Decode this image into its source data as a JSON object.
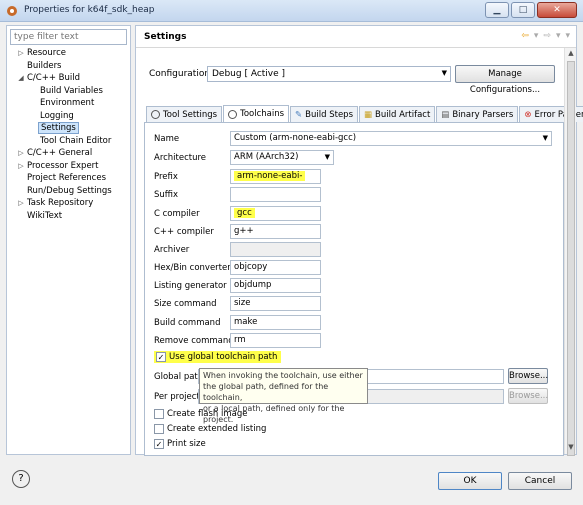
{
  "window": {
    "title": "Properties for k64f_sdk_heap",
    "minimize": "▁",
    "maximize": "□",
    "close": "✕"
  },
  "nav": {
    "filter_placeholder": "type filter text",
    "items": [
      {
        "label": "Resource",
        "arrow": "▷"
      },
      {
        "label": "Builders",
        "arrow": ""
      },
      {
        "label": "C/C++ Build",
        "arrow": "◢"
      },
      {
        "label": "Build Variables",
        "arrow": ""
      },
      {
        "label": "Environment",
        "arrow": ""
      },
      {
        "label": "Logging",
        "arrow": ""
      },
      {
        "label": "Settings",
        "arrow": ""
      },
      {
        "label": "Tool Chain Editor",
        "arrow": ""
      },
      {
        "label": "C/C++ General",
        "arrow": "▷"
      },
      {
        "label": "Processor Expert",
        "arrow": "▷"
      },
      {
        "label": "Project References",
        "arrow": ""
      },
      {
        "label": "Run/Debug Settings",
        "arrow": ""
      },
      {
        "label": "Task Repository",
        "arrow": "▷"
      },
      {
        "label": "WikiText",
        "arrow": ""
      }
    ]
  },
  "header": {
    "title": "Settings",
    "back_icon": "⇦",
    "fwd_icon": "⇨",
    "dropdown": "▾",
    "menu": "▾"
  },
  "config": {
    "label": "Configuration:",
    "value": "Debug  [ Active ]",
    "manage": "Manage Configurations..."
  },
  "tabs": [
    "Tool Settings",
    "Toolchains",
    "Build Steps",
    "Build Artifact",
    "Binary Parsers",
    "Error Parsers"
  ],
  "form": {
    "name": {
      "label": "Name",
      "value": "Custom (arm-none-eabi-gcc)"
    },
    "architecture": {
      "label": "Architecture",
      "value": "ARM (AArch32)"
    },
    "prefix": {
      "label": "Prefix",
      "value": "arm-none-eabi-"
    },
    "suffix": {
      "label": "Suffix",
      "value": ""
    },
    "c_compiler": {
      "label": "C compiler",
      "value": "gcc"
    },
    "cpp_compiler": {
      "label": "C++ compiler",
      "value": "g++"
    },
    "archiver": {
      "label": "Archiver",
      "value": ""
    },
    "hexbin": {
      "label": "Hex/Bin converter",
      "value": "objcopy"
    },
    "listing": {
      "label": "Listing generator",
      "value": "objdump"
    },
    "size": {
      "label": "Size command",
      "value": "size"
    },
    "build": {
      "label": "Build command",
      "value": "make"
    },
    "remove": {
      "label": "Remove command",
      "value": "rm"
    },
    "use_global": {
      "label": "Use global toolchain path",
      "checked": "✓"
    },
    "global_path": {
      "label": "Global path",
      "browse": "Browse..."
    },
    "project_path": {
      "label": "Per project p",
      "browse": "Browse..."
    },
    "flash": {
      "label": "Create flash image",
      "checked": ""
    },
    "ext_listing": {
      "label": "Create extended listing",
      "checked": ""
    },
    "print_size": {
      "label": "Print size",
      "checked": "✓"
    }
  },
  "tooltip": {
    "line1": "When invoking the toolchain, use either",
    "line2": "the global path, defined for the toolchain,",
    "line3": "or a local path, defined only for the project."
  },
  "footer": {
    "help": "?",
    "ok": "OK",
    "cancel": "Cancel"
  }
}
